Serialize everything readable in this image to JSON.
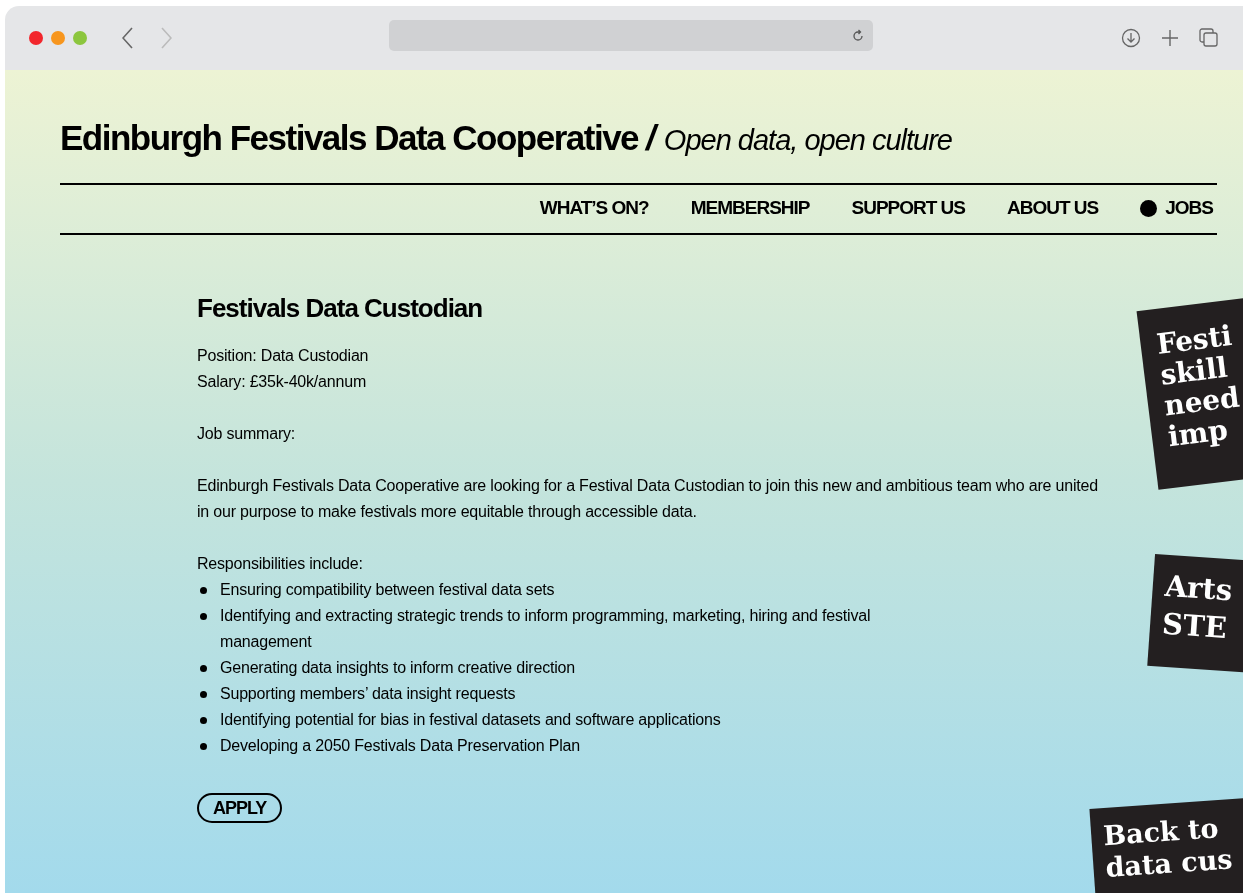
{
  "site": {
    "title": "Edinburgh Festivals Data Cooperative",
    "separator": "/",
    "tagline": "Open data, open culture"
  },
  "nav": [
    {
      "label": "WHAT’S ON?",
      "selected": false
    },
    {
      "label": "MEMBERSHIP",
      "selected": false
    },
    {
      "label": "SUPPORT US",
      "selected": false
    },
    {
      "label": "ABOUT US",
      "selected": false
    },
    {
      "label": "JOBS",
      "selected": true
    }
  ],
  "job": {
    "title": "Festivals Data Custodian",
    "position": "Position: Data Custodian",
    "salary": "Salary: £35k-40k/annum",
    "summary_label": "Job summary:",
    "summary": "Edinburgh Festivals Data Cooperative are looking for a Festival Data Custodian to join this new and ambitious team who are united in our purpose to make festivals more equitable through accessible data.",
    "responsibilities_label": "Responsibilities include:",
    "responsibilities": [
      "Ensuring compatibility between festival data sets",
      "Identifying and extracting strategic trends to inform programming, marketing, hiring and festival management",
      "Generating data insights to inform creative direction",
      "Supporting members’ data insight requests",
      "Identifying potential for bias in festival datasets and software applications",
      "Developing a 2050 Festivals Data Preservation Plan"
    ],
    "apply": "APPLY"
  },
  "stickers": [
    {
      "lines": [
        "Festi",
        "skill",
        "need",
        "imp"
      ]
    },
    {
      "lines": [
        "Arts",
        "STE"
      ]
    },
    {
      "lines": [
        "Back to",
        "data cus"
      ]
    }
  ]
}
